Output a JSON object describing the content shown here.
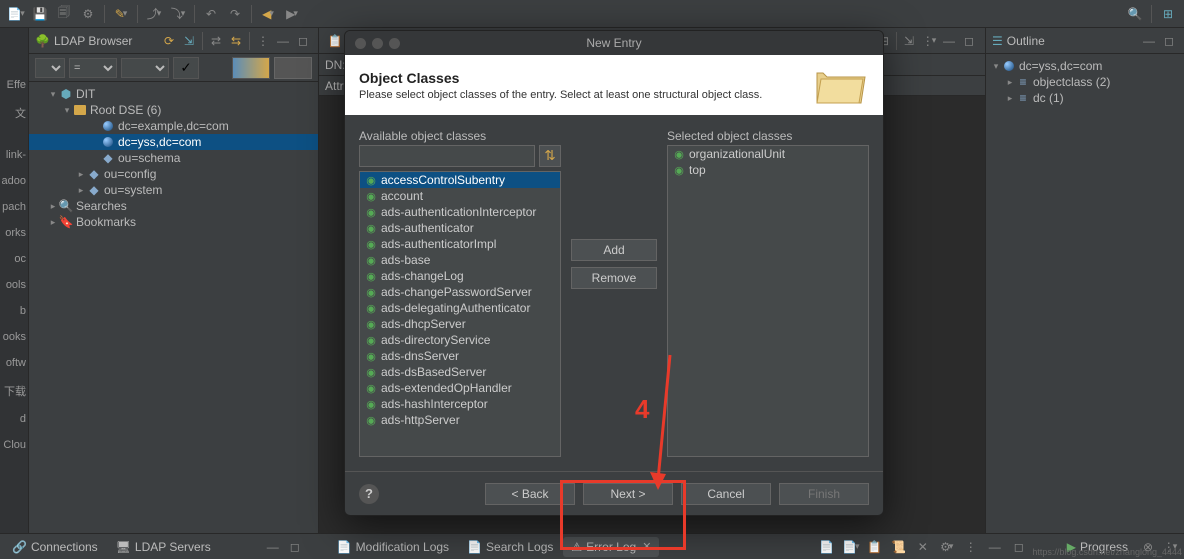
{
  "toolbar": {
    "search_icon": "search",
    "perspective_icon": "perspective"
  },
  "left_strip_items": [
    "",
    "Effe",
    "文",
    "",
    "",
    "link-",
    "adoo",
    "pach",
    "orks",
    "oc",
    "ools",
    "b",
    "ooks",
    "oftw",
    "下载",
    "d",
    "Clou"
  ],
  "ldap": {
    "title": "LDAP Browser",
    "filter_eq": "=",
    "tree": [
      {
        "label": "DIT",
        "depth": 1,
        "arrow": "▾",
        "icon": "dit"
      },
      {
        "label": "Root DSE (6)",
        "depth": 2,
        "arrow": "▾",
        "icon": "folder-y"
      },
      {
        "label": "dc=example,dc=com",
        "depth": 4,
        "arrow": "",
        "icon": "globe"
      },
      {
        "label": "dc=yss,dc=com",
        "depth": 4,
        "arrow": "",
        "icon": "globe",
        "selected": true
      },
      {
        "label": "ou=schema",
        "depth": 4,
        "arrow": "",
        "icon": "ou"
      },
      {
        "label": "ou=config",
        "depth": 3,
        "arrow": "▸",
        "icon": "ou"
      },
      {
        "label": "ou=system",
        "depth": 3,
        "arrow": "▸",
        "icon": "ou"
      },
      {
        "label": "Searches",
        "depth": 1,
        "arrow": "▸",
        "icon": "search"
      },
      {
        "label": "Bookmarks",
        "depth": 1,
        "arrow": "▸",
        "icon": "bookmark"
      }
    ]
  },
  "center": {
    "dn_label": "DN:",
    "attr_header": "Attri"
  },
  "outline": {
    "title": "Outline",
    "tree": [
      {
        "label": "dc=yss,dc=com",
        "depth": 0,
        "arrow": "▾",
        "icon": "globe"
      },
      {
        "label": "objectclass (2)",
        "depth": 1,
        "arrow": "▸",
        "icon": "list"
      },
      {
        "label": "dc (1)",
        "depth": 1,
        "arrow": "▸",
        "icon": "list"
      }
    ]
  },
  "dialog": {
    "title": "New Entry",
    "banner_title": "Object Classes",
    "banner_sub": "Please select object classes of the entry. Select at least one structural object class.",
    "available_label": "Available object classes",
    "selected_label": "Selected object classes",
    "search_value": "",
    "available": [
      "accessControlSubentry",
      "account",
      "ads-authenticationInterceptor",
      "ads-authenticator",
      "ads-authenticatorImpl",
      "ads-base",
      "ads-changeLog",
      "ads-changePasswordServer",
      "ads-delegatingAuthenticator",
      "ads-dhcpServer",
      "ads-directoryService",
      "ads-dnsServer",
      "ads-dsBasedServer",
      "ads-extendedOpHandler",
      "ads-hashInterceptor",
      "ads-httpServer"
    ],
    "available_selected_index": 0,
    "selected": [
      "organizationalUnit",
      "top"
    ],
    "btn_add": "Add",
    "btn_remove": "Remove",
    "btn_back": "< Back",
    "btn_next": "Next >",
    "btn_cancel": "Cancel",
    "btn_finish": "Finish"
  },
  "annotation": {
    "number": "4"
  },
  "status": {
    "tabs": [
      {
        "label": "Connections",
        "icon": "conn"
      },
      {
        "label": "LDAP Servers",
        "icon": "serv"
      },
      {
        "label": "Modification Logs",
        "icon": "log"
      },
      {
        "label": "Search Logs",
        "icon": "log"
      },
      {
        "label": "Error Log",
        "icon": "err",
        "active": true,
        "close": true
      }
    ],
    "progress": "Progress"
  },
  "watermark": "https://blog.csdn.net/zhanglong_4444"
}
